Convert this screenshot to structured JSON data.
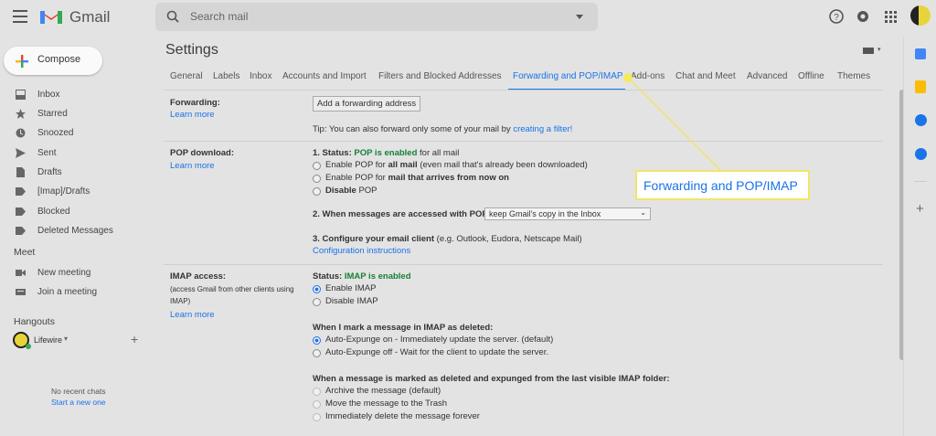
{
  "header": {
    "app_name": "Gmail",
    "search_placeholder": "Search mail"
  },
  "compose": {
    "label": "Compose"
  },
  "nav": [
    {
      "label": "Inbox",
      "icon": "inbox-icon"
    },
    {
      "label": "Starred",
      "icon": "star-icon"
    },
    {
      "label": "Snoozed",
      "icon": "clock-icon"
    },
    {
      "label": "Sent",
      "icon": "send-icon"
    },
    {
      "label": "Drafts",
      "icon": "draft-icon"
    },
    {
      "label": "[Imap]/Drafts",
      "icon": "label-icon"
    },
    {
      "label": "Blocked",
      "icon": "label-icon"
    },
    {
      "label": "Deleted Messages",
      "icon": "label-icon"
    }
  ],
  "meet": {
    "title": "Meet",
    "new_meeting": "New meeting",
    "join": "Join a meeting"
  },
  "hangouts": {
    "title": "Hangouts",
    "user": "Lifewire",
    "no_chats": "No recent chats",
    "start_new": "Start a new one"
  },
  "settings": {
    "title": "Settings",
    "tabs": [
      "General",
      "Labels",
      "Inbox",
      "Accounts and Import",
      "Filters and Blocked Addresses",
      "Forwarding and POP/IMAP",
      "Add-ons",
      "Chat and Meet",
      "Advanced",
      "Offline",
      "Themes"
    ],
    "forwarding": {
      "label": "Forwarding:",
      "learn_more": "Learn more",
      "button": "Add a forwarding address",
      "tip": "Tip: You can also forward only some of your mail by",
      "tip_link": "creating a filter!"
    },
    "pop": {
      "label": "POP download:",
      "learn_more": "Learn more",
      "status_prefix": "1. Status:",
      "status_value": "POP is enabled",
      "status_suffix": "for all mail",
      "opt1_a": "Enable POP for",
      "opt1_b": "all mail",
      "opt1_c": "(even mail that's already been downloaded)",
      "opt2_a": "Enable POP for",
      "opt2_b": "mail that arrives from now on",
      "opt3": "Disable",
      "opt3_b": "POP",
      "when_label": "2. When messages are accessed with POP",
      "when_value": "keep Gmail's copy in the Inbox",
      "config_label": "3. Configure your email client",
      "config_hint": "(e.g. Outlook, Eudora, Netscape Mail)",
      "config_link": "Configuration instructions"
    },
    "imap": {
      "label": "IMAP access:",
      "desc1": "(access Gmail from other clients using",
      "desc2": "IMAP)",
      "learn_more": "Learn more",
      "status_prefix": "Status:",
      "status_value": "IMAP is enabled",
      "enable": "Enable IMAP",
      "disable": "Disable IMAP",
      "deleted_label": "When I mark a message in IMAP as deleted:",
      "expunge_on": "Auto-Expunge on - Immediately update the server. (default)",
      "expunge_off": "Auto-Expunge off - Wait for the client to update the server.",
      "expunged_label": "When a message is marked as deleted and expunged from the last visible IMAP folder:",
      "archive": "Archive the message (default)",
      "trash": "Move the message to the Trash",
      "delete": "Immediately delete the message forever"
    }
  },
  "callout": {
    "text": "Forwarding and POP/IMAP"
  },
  "colors": {
    "accent": "#1a73e8",
    "enabled": "#188038",
    "callout_border": "#f1e56a"
  }
}
